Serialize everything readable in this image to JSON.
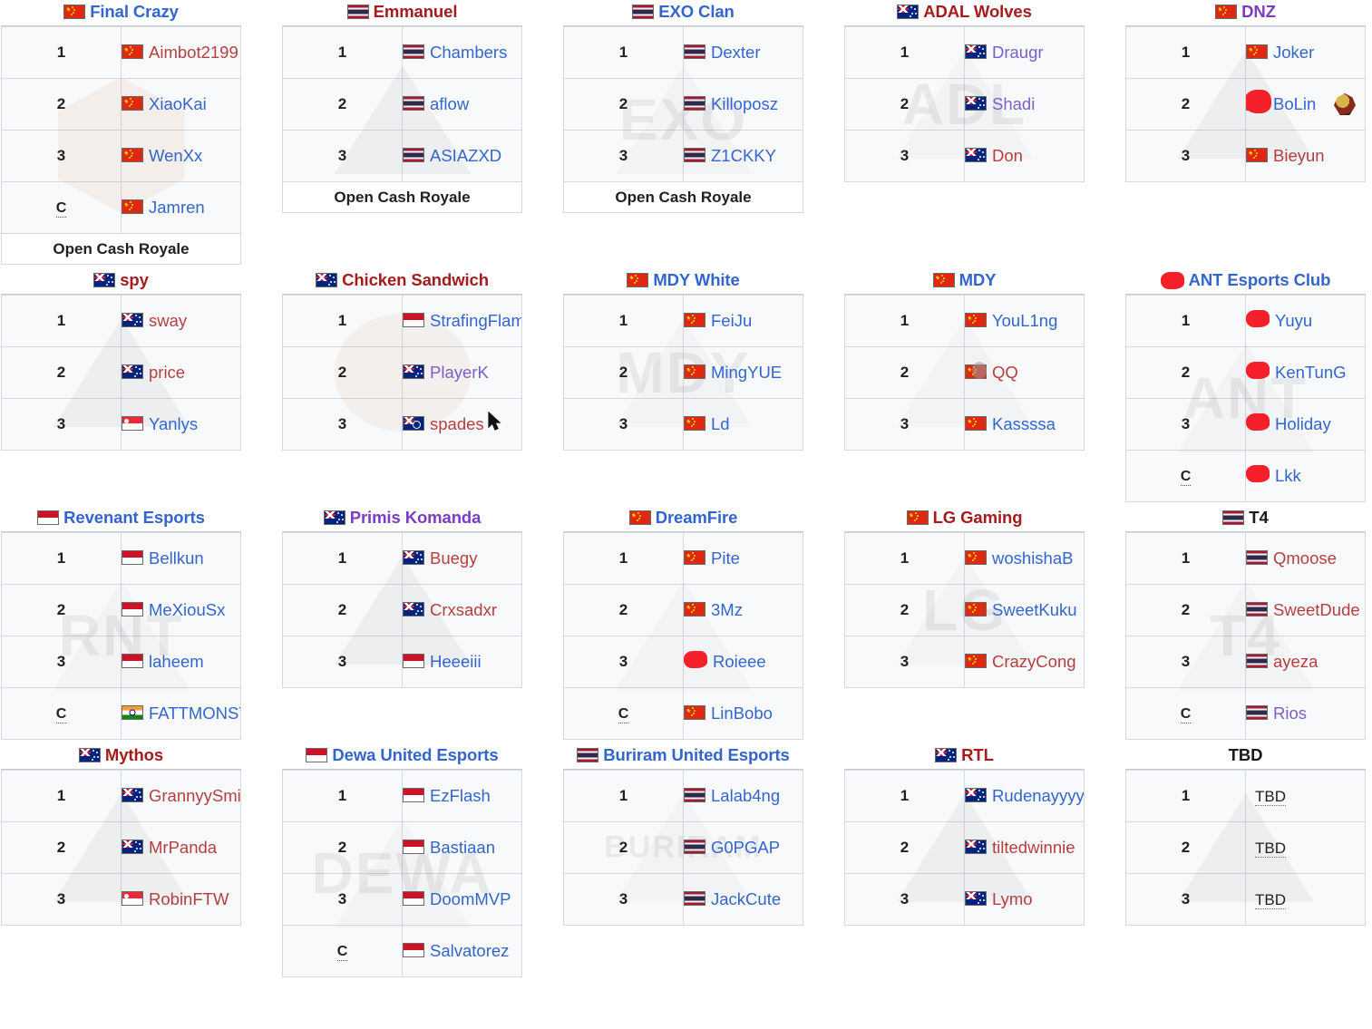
{
  "meta": {
    "qualifier_label": "Open Cash Royale",
    "coach_marker": "C",
    "tbd_label": "TBD"
  },
  "colors": {
    "link_blue": "#3366cc",
    "link_red": "#b53f3f",
    "link_purple": "#7a5fc8",
    "title_blue": "#3366cc",
    "title_red": "#a41c1c",
    "title_purple": "#7a3ec4",
    "title_black": "#1a1a1a",
    "table_border": "#c8ccd1",
    "table_bg": "#f8f9fa"
  },
  "teams": [
    {
      "name": "Final Crazy",
      "flag": "cn",
      "title_color": "blue",
      "qualifier": "Open Cash Royale",
      "watermark": "hexa",
      "players": [
        {
          "idx": "1",
          "flag": "cn",
          "name": "Aimbot2199",
          "color": "red"
        },
        {
          "idx": "2",
          "flag": "cn",
          "name": "XiaoKai",
          "color": "blue"
        },
        {
          "idx": "3",
          "flag": "cn",
          "name": "WenXx",
          "color": "blue"
        },
        {
          "idx": "C",
          "flag": "cn",
          "name": "Jamren",
          "color": "blue",
          "coach": true
        }
      ]
    },
    {
      "name": "Emmanuel",
      "flag": "th",
      "title_color": "red",
      "qualifier": "Open Cash Royale",
      "watermark": "tri",
      "players": [
        {
          "idx": "1",
          "flag": "th",
          "name": "Chambers",
          "color": "blue"
        },
        {
          "idx": "2",
          "flag": "th",
          "name": "aflow",
          "color": "blue"
        },
        {
          "idx": "3",
          "flag": "th",
          "name": "ASIAZXD",
          "color": "blue"
        }
      ]
    },
    {
      "name": "EXO Clan",
      "flag": "th",
      "title_color": "blue",
      "qualifier": "Open Cash Royale",
      "watermark": "star",
      "watermark_text": "EXO",
      "players": [
        {
          "idx": "1",
          "flag": "th",
          "name": "Dexter",
          "color": "blue"
        },
        {
          "idx": "2",
          "flag": "th",
          "name": "Killoposz",
          "color": "blue"
        },
        {
          "idx": "3",
          "flag": "th",
          "name": "Z1CKKY",
          "color": "blue"
        }
      ]
    },
    {
      "name": "ADAL Wolves",
      "flag": "au",
      "title_color": "red",
      "qualifier": null,
      "watermark": "text",
      "watermark_text": "ADL",
      "players": [
        {
          "idx": "1",
          "flag": "au",
          "name": "Draugr",
          "color": "purple"
        },
        {
          "idx": "2",
          "flag": "au",
          "name": "Shadi",
          "color": "purple"
        },
        {
          "idx": "3",
          "flag": "au",
          "name": "Don",
          "color": "red"
        }
      ]
    },
    {
      "name": "DNZ",
      "flag": "cn",
      "title_color": "purple",
      "qualifier": null,
      "watermark": "chevron",
      "players": [
        {
          "idx": "1",
          "flag": "cn",
          "name": "Joker",
          "color": "blue"
        },
        {
          "idx": "2",
          "flag": "cn",
          "name": "BoLin",
          "color": "blue",
          "cursor_blob": true,
          "team_logo": true
        },
        {
          "idx": "3",
          "flag": "cn",
          "name": "Bieyun",
          "color": "red"
        }
      ]
    },
    {
      "name": "spy",
      "flag": "au",
      "title_color": "red",
      "qualifier": null,
      "watermark": "tri",
      "players": [
        {
          "idx": "1",
          "flag": "au",
          "name": "sway",
          "color": "red"
        },
        {
          "idx": "2",
          "flag": "au",
          "name": "price",
          "color": "red"
        },
        {
          "idx": "3",
          "flag": "sg",
          "name": "Yanlys",
          "color": "blue"
        }
      ]
    },
    {
      "name": "Chicken Sandwich",
      "flag": "au",
      "title_color": "red",
      "qualifier": null,
      "watermark": "blobcircle",
      "players": [
        {
          "idx": "1",
          "flag": "id",
          "name": "StrafingFlame",
          "color": "blue"
        },
        {
          "idx": "2",
          "flag": "au",
          "name": "PlayerK",
          "color": "purple"
        },
        {
          "idx": "3",
          "flag": "nz",
          "name": "spades",
          "color": "red",
          "cursor_arrow": true
        }
      ]
    },
    {
      "name": "MDY White",
      "flag": "cn",
      "title_color": "blue",
      "qualifier": null,
      "watermark": "text",
      "watermark_text": "MDY",
      "players": [
        {
          "idx": "1",
          "flag": "cn",
          "name": "FeiJu",
          "color": "blue"
        },
        {
          "idx": "2",
          "flag": "cn",
          "name": "MingYUE",
          "color": "blue"
        },
        {
          "idx": "3",
          "flag": "cn",
          "name": "Ld",
          "color": "blue"
        }
      ]
    },
    {
      "name": "MDY",
      "flag": "cn",
      "title_color": "blue",
      "qualifier": null,
      "watermark": "helm",
      "players": [
        {
          "idx": "1",
          "flag": "cn",
          "name": "YouL1ng",
          "color": "blue"
        },
        {
          "idx": "2",
          "flag": "cn",
          "name": "QQ",
          "color": "red",
          "flag_overlay": true
        },
        {
          "idx": "3",
          "flag": "cn",
          "name": "Kassssa",
          "color": "blue"
        }
      ]
    },
    {
      "name": "ANT Esports Club",
      "flag": "redacted",
      "title_color": "blue",
      "qualifier": null,
      "watermark": "ant",
      "watermark_text": "ANT",
      "players": [
        {
          "idx": "1",
          "flag": "redacted",
          "name": "Yuyu",
          "color": "blue"
        },
        {
          "idx": "2",
          "flag": "redacted",
          "name": "KenTunG",
          "color": "blue"
        },
        {
          "idx": "3",
          "flag": "redacted",
          "name": "Holiday",
          "color": "blue"
        },
        {
          "idx": "C",
          "flag": "redacted",
          "name": "Lkk",
          "color": "blue",
          "coach": true
        }
      ]
    },
    {
      "name": "Revenant Esports",
      "flag": "id",
      "title_color": "blue",
      "qualifier": null,
      "watermark": "text",
      "watermark_text": "RNT",
      "players": [
        {
          "idx": "1",
          "flag": "id",
          "name": "Bellkun",
          "color": "blue"
        },
        {
          "idx": "2",
          "flag": "id",
          "name": "MeXiouSx",
          "color": "blue"
        },
        {
          "idx": "3",
          "flag": "id",
          "name": "laheem",
          "color": "blue"
        },
        {
          "idx": "C",
          "flag": "in",
          "name": "FATTMONSTER",
          "color": "blue",
          "coach": true
        }
      ]
    },
    {
      "name": "Primis Komanda",
      "flag": "au",
      "title_color": "purple",
      "qualifier": null,
      "watermark": "tri",
      "players": [
        {
          "idx": "1",
          "flag": "au",
          "name": "Buegy",
          "color": "red"
        },
        {
          "idx": "2",
          "flag": "au",
          "name": "Crxsadxr",
          "color": "red"
        },
        {
          "idx": "3",
          "flag": "id",
          "name": "Heeeiii",
          "color": "blue"
        }
      ]
    },
    {
      "name": "DreamFire",
      "flag": "cn",
      "title_color": "blue",
      "qualifier": null,
      "watermark": "shield",
      "players": [
        {
          "idx": "1",
          "flag": "cn",
          "name": "Pite",
          "color": "blue"
        },
        {
          "idx": "2",
          "flag": "cn",
          "name": "3Mz",
          "color": "blue"
        },
        {
          "idx": "3",
          "flag": "redacted",
          "name": "Roieee",
          "color": "blue"
        },
        {
          "idx": "C",
          "flag": "cn",
          "name": "LinBobo",
          "color": "blue",
          "coach": true
        }
      ]
    },
    {
      "name": "LG Gaming",
      "flag": "cn",
      "title_color": "red",
      "qualifier": null,
      "watermark": "text",
      "watermark_text": "LG",
      "players": [
        {
          "idx": "1",
          "flag": "cn",
          "name": "woshishaB",
          "color": "blue"
        },
        {
          "idx": "2",
          "flag": "cn",
          "name": "SweetKuku",
          "color": "blue"
        },
        {
          "idx": "3",
          "flag": "cn",
          "name": "CrazyCong",
          "color": "red"
        }
      ]
    },
    {
      "name": "T4",
      "flag": "th",
      "title_color": "black",
      "qualifier": null,
      "watermark": "text",
      "watermark_text": "T4",
      "players": [
        {
          "idx": "1",
          "flag": "th",
          "name": "Qmoose",
          "color": "red"
        },
        {
          "idx": "2",
          "flag": "th",
          "name": "SweetDude",
          "color": "red"
        },
        {
          "idx": "3",
          "flag": "th",
          "name": "ayeza",
          "color": "red"
        },
        {
          "idx": "C",
          "flag": "th",
          "name": "Rios",
          "color": "purple",
          "coach": true
        }
      ]
    },
    {
      "name": "Mythos",
      "flag": "au",
      "title_color": "red",
      "qualifier": null,
      "watermark": "tri",
      "players": [
        {
          "idx": "1",
          "flag": "au",
          "name": "GrannyySmith",
          "color": "red"
        },
        {
          "idx": "2",
          "flag": "au",
          "name": "MrPanda",
          "color": "red"
        },
        {
          "idx": "3",
          "flag": "sg",
          "name": "RobinFTW",
          "color": "red"
        }
      ]
    },
    {
      "name": "Dewa United Esports",
      "flag": "id",
      "title_color": "blue",
      "qualifier": null,
      "watermark": "text",
      "watermark_text": "DEWA",
      "players": [
        {
          "idx": "1",
          "flag": "id",
          "name": "EzFlash",
          "color": "blue"
        },
        {
          "idx": "2",
          "flag": "id",
          "name": "Bastiaan",
          "color": "blue"
        },
        {
          "idx": "3",
          "flag": "id",
          "name": "DoomMVP",
          "color": "blue"
        },
        {
          "idx": "C",
          "flag": "id",
          "name": "Salvatorez",
          "color": "blue",
          "coach": true
        }
      ]
    },
    {
      "name": "Buriram United Esports",
      "flag": "th",
      "title_color": "blue",
      "qualifier": null,
      "watermark": "shield",
      "watermark_text": "BURIRAM",
      "players": [
        {
          "idx": "1",
          "flag": "th",
          "name": "Lalab4ng",
          "color": "blue"
        },
        {
          "idx": "2",
          "flag": "th",
          "name": "G0PGAP",
          "color": "blue"
        },
        {
          "idx": "3",
          "flag": "th",
          "name": "JackCute",
          "color": "blue"
        }
      ]
    },
    {
      "name": "RTL",
      "flag": "au",
      "title_color": "red",
      "qualifier": null,
      "watermark": "tri",
      "players": [
        {
          "idx": "1",
          "flag": "au",
          "name": "Rudenayyyyy",
          "color": "blue"
        },
        {
          "idx": "2",
          "flag": "au",
          "name": "tiltedwinnie",
          "color": "red"
        },
        {
          "idx": "3",
          "flag": "au",
          "name": "Lymo",
          "color": "red"
        }
      ]
    },
    {
      "name": "TBD",
      "flag": null,
      "title_color": "black",
      "qualifier": null,
      "watermark": "tri",
      "players": [
        {
          "idx": "1",
          "flag": null,
          "name": "TBD",
          "color": "tbd"
        },
        {
          "idx": "2",
          "flag": null,
          "name": "TBD",
          "color": "tbd"
        },
        {
          "idx": "3",
          "flag": null,
          "name": "TBD",
          "color": "tbd"
        }
      ]
    }
  ]
}
